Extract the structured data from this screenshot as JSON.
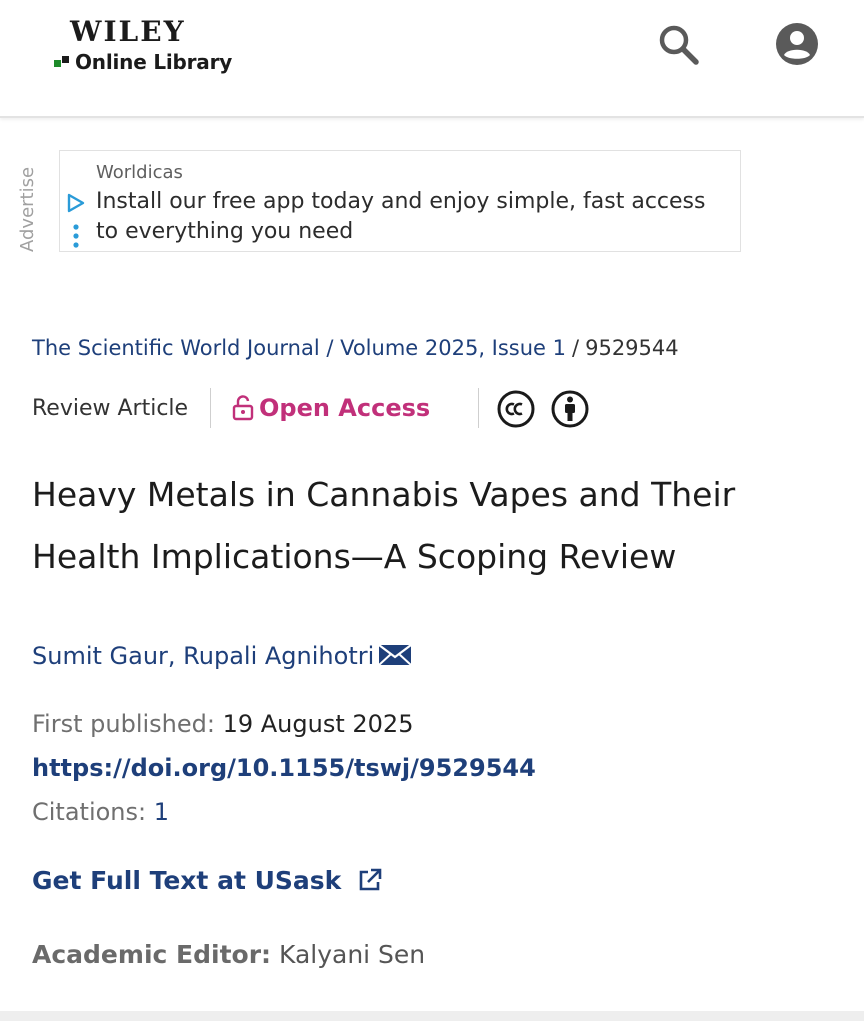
{
  "header": {
    "logo_top": "WILEY",
    "logo_bottom": "Online Library",
    "search_icon": "search-icon",
    "account_icon": "account-icon"
  },
  "ad": {
    "side_label": "Advertise",
    "brand": "Worldicas",
    "text": "Install our free app today and enjoy simple, fast access to everything you need"
  },
  "breadcrumb": {
    "journal": "The Scientific World Journal / Volume 2025, Issue 1",
    "separator": "/",
    "article_id": "9529544"
  },
  "article_meta": {
    "type": "Review Article",
    "access": "Open Access",
    "license_icons": [
      "cc-icon",
      "cc-by-icon"
    ]
  },
  "article": {
    "title": "Heavy Metals in Cannabis Vapes and Their Health Implications—A Scoping Review",
    "authors": "Sumit Gaur, Rupali Agnihotri",
    "first_published_label": "First published:",
    "first_published_date": "19 August 2025",
    "doi": "https://doi.org/10.1155/tswj/9529544",
    "citations_label": "Citations:",
    "citations_count": "1",
    "full_text_link": "Get Full Text at USask",
    "editor_label": "Academic Editor:",
    "editor_name": "Kalyani Sen"
  },
  "colors": {
    "link_blue": "#1e3f7a",
    "open_access_magenta": "#c1307a",
    "wiley_green": "#1d8b2a"
  }
}
